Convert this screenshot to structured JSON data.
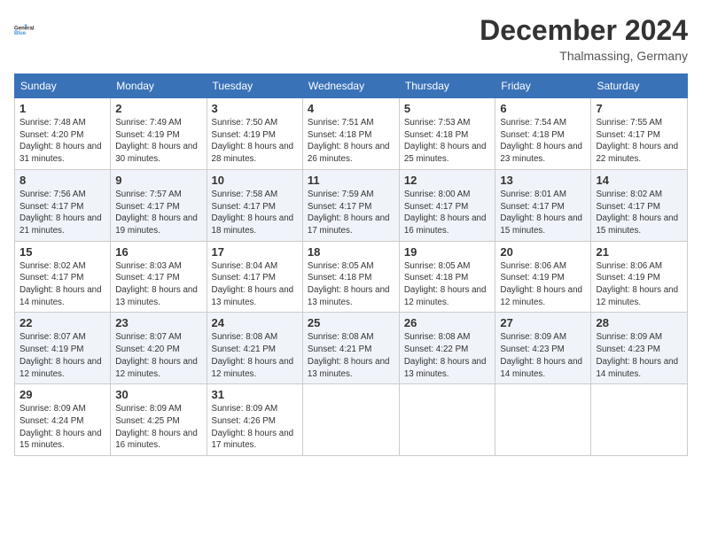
{
  "logo": {
    "line1": "General",
    "line2": "Blue"
  },
  "title": "December 2024",
  "location": "Thalmassing, Germany",
  "days_of_week": [
    "Sunday",
    "Monday",
    "Tuesday",
    "Wednesday",
    "Thursday",
    "Friday",
    "Saturday"
  ],
  "weeks": [
    [
      {
        "day": "1",
        "sunrise": "7:48 AM",
        "sunset": "4:20 PM",
        "daylight": "8 hours and 31 minutes."
      },
      {
        "day": "2",
        "sunrise": "7:49 AM",
        "sunset": "4:19 PM",
        "daylight": "8 hours and 30 minutes."
      },
      {
        "day": "3",
        "sunrise": "7:50 AM",
        "sunset": "4:19 PM",
        "daylight": "8 hours and 28 minutes."
      },
      {
        "day": "4",
        "sunrise": "7:51 AM",
        "sunset": "4:18 PM",
        "daylight": "8 hours and 26 minutes."
      },
      {
        "day": "5",
        "sunrise": "7:53 AM",
        "sunset": "4:18 PM",
        "daylight": "8 hours and 25 minutes."
      },
      {
        "day": "6",
        "sunrise": "7:54 AM",
        "sunset": "4:18 PM",
        "daylight": "8 hours and 23 minutes."
      },
      {
        "day": "7",
        "sunrise": "7:55 AM",
        "sunset": "4:17 PM",
        "daylight": "8 hours and 22 minutes."
      }
    ],
    [
      {
        "day": "8",
        "sunrise": "7:56 AM",
        "sunset": "4:17 PM",
        "daylight": "8 hours and 21 minutes."
      },
      {
        "day": "9",
        "sunrise": "7:57 AM",
        "sunset": "4:17 PM",
        "daylight": "8 hours and 19 minutes."
      },
      {
        "day": "10",
        "sunrise": "7:58 AM",
        "sunset": "4:17 PM",
        "daylight": "8 hours and 18 minutes."
      },
      {
        "day": "11",
        "sunrise": "7:59 AM",
        "sunset": "4:17 PM",
        "daylight": "8 hours and 17 minutes."
      },
      {
        "day": "12",
        "sunrise": "8:00 AM",
        "sunset": "4:17 PM",
        "daylight": "8 hours and 16 minutes."
      },
      {
        "day": "13",
        "sunrise": "8:01 AM",
        "sunset": "4:17 PM",
        "daylight": "8 hours and 15 minutes."
      },
      {
        "day": "14",
        "sunrise": "8:02 AM",
        "sunset": "4:17 PM",
        "daylight": "8 hours and 15 minutes."
      }
    ],
    [
      {
        "day": "15",
        "sunrise": "8:02 AM",
        "sunset": "4:17 PM",
        "daylight": "8 hours and 14 minutes."
      },
      {
        "day": "16",
        "sunrise": "8:03 AM",
        "sunset": "4:17 PM",
        "daylight": "8 hours and 13 minutes."
      },
      {
        "day": "17",
        "sunrise": "8:04 AM",
        "sunset": "4:17 PM",
        "daylight": "8 hours and 13 minutes."
      },
      {
        "day": "18",
        "sunrise": "8:05 AM",
        "sunset": "4:18 PM",
        "daylight": "8 hours and 13 minutes."
      },
      {
        "day": "19",
        "sunrise": "8:05 AM",
        "sunset": "4:18 PM",
        "daylight": "8 hours and 12 minutes."
      },
      {
        "day": "20",
        "sunrise": "8:06 AM",
        "sunset": "4:19 PM",
        "daylight": "8 hours and 12 minutes."
      },
      {
        "day": "21",
        "sunrise": "8:06 AM",
        "sunset": "4:19 PM",
        "daylight": "8 hours and 12 minutes."
      }
    ],
    [
      {
        "day": "22",
        "sunrise": "8:07 AM",
        "sunset": "4:19 PM",
        "daylight": "8 hours and 12 minutes."
      },
      {
        "day": "23",
        "sunrise": "8:07 AM",
        "sunset": "4:20 PM",
        "daylight": "8 hours and 12 minutes."
      },
      {
        "day": "24",
        "sunrise": "8:08 AM",
        "sunset": "4:21 PM",
        "daylight": "8 hours and 12 minutes."
      },
      {
        "day": "25",
        "sunrise": "8:08 AM",
        "sunset": "4:21 PM",
        "daylight": "8 hours and 13 minutes."
      },
      {
        "day": "26",
        "sunrise": "8:08 AM",
        "sunset": "4:22 PM",
        "daylight": "8 hours and 13 minutes."
      },
      {
        "day": "27",
        "sunrise": "8:09 AM",
        "sunset": "4:23 PM",
        "daylight": "8 hours and 14 minutes."
      },
      {
        "day": "28",
        "sunrise": "8:09 AM",
        "sunset": "4:23 PM",
        "daylight": "8 hours and 14 minutes."
      }
    ],
    [
      {
        "day": "29",
        "sunrise": "8:09 AM",
        "sunset": "4:24 PM",
        "daylight": "8 hours and 15 minutes."
      },
      {
        "day": "30",
        "sunrise": "8:09 AM",
        "sunset": "4:25 PM",
        "daylight": "8 hours and 16 minutes."
      },
      {
        "day": "31",
        "sunrise": "8:09 AM",
        "sunset": "4:26 PM",
        "daylight": "8 hours and 17 minutes."
      },
      null,
      null,
      null,
      null
    ]
  ],
  "labels": {
    "sunrise": "Sunrise:",
    "sunset": "Sunset:",
    "daylight": "Daylight:"
  }
}
